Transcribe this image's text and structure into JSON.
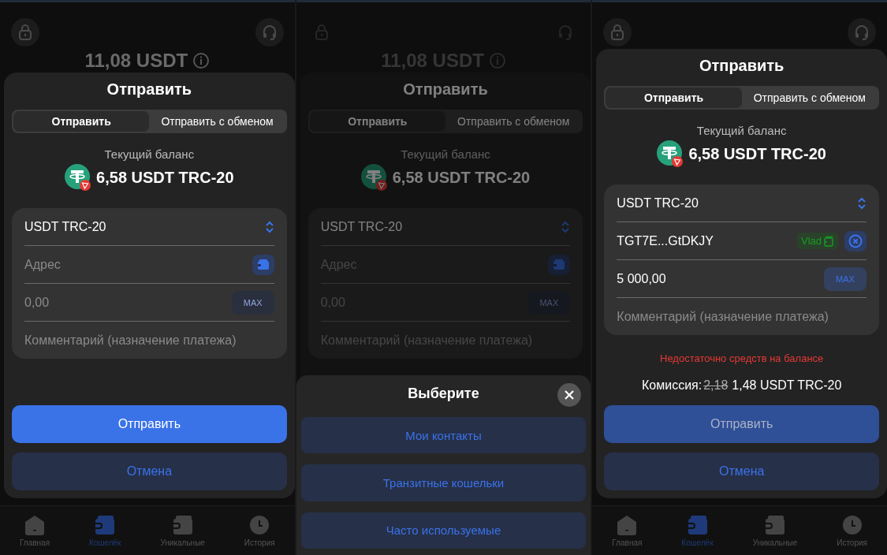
{
  "screens": [
    {
      "total_balance": "11,08 USDT",
      "dimmed": false,
      "sheet": {
        "title": "Отправить",
        "tabs": [
          {
            "label": "Отправить",
            "selected": true
          },
          {
            "label": "Отправить с обменом",
            "selected": false
          }
        ],
        "balance_label": "Текущий баланс",
        "balance": "6,58 USDT TRC-20",
        "asset": "USDT TRC-20",
        "address": {
          "placeholder": "Адрес"
        },
        "amount": {
          "placeholder": "0,00",
          "max_label": "MAX",
          "max_enabled": false
        },
        "comment": {
          "placeholder": "Комментарий (назначение платежа)"
        },
        "buttons": [
          {
            "label": "Отправить",
            "kind": "primary",
            "disabled": false
          },
          {
            "label": "Отмена",
            "kind": "secondary",
            "disabled": false
          }
        ]
      },
      "nav": [
        {
          "label": "Главная",
          "kind": "home",
          "selected": false
        },
        {
          "label": "Кошелёк",
          "kind": "wallet",
          "selected": true
        },
        {
          "label": "Уникальные",
          "kind": "unique",
          "selected": false
        },
        {
          "label": "История",
          "kind": "history",
          "selected": false
        }
      ]
    },
    {
      "total_balance": "11,08 USDT",
      "dimmed": true,
      "sheet": {
        "title": "Отправить",
        "tabs": [
          {
            "label": "Отправить",
            "selected": true
          },
          {
            "label": "Отправить с обменом",
            "selected": false
          }
        ],
        "balance_label": "Текущий баланс",
        "balance": "6,58 USDT TRC-20",
        "asset": "USDT TRC-20",
        "address": {
          "placeholder": "Адрес"
        },
        "amount": {
          "placeholder": "0,00",
          "max_label": "MAX",
          "max_enabled": false
        },
        "comment": {
          "placeholder": "Комментарий (назначение платежа)"
        }
      },
      "picker": {
        "title": "Выберите",
        "options": [
          "Мои контакты",
          "Транзитные кошельки",
          "Часто используемые"
        ]
      }
    },
    {
      "dimmed": false,
      "sheet": {
        "title": "Отправить",
        "tabs": [
          {
            "label": "Отправить",
            "selected": true
          },
          {
            "label": "Отправить с обменом",
            "selected": false
          }
        ],
        "balance_label": "Текущий баланс",
        "balance": "6,58 USDT TRC-20",
        "asset": "USDT TRC-20",
        "address": {
          "value": "TGT7E...GtDKJY",
          "contact": "Vlad"
        },
        "amount": {
          "value": "5 000,00",
          "max_label": "MAX",
          "max_enabled": true
        },
        "comment": {
          "placeholder": "Комментарий (назначение платежа)"
        },
        "error": "Недостаточно средств на балансе",
        "fee": {
          "label": "Комиссия:",
          "old_value": "2,18",
          "value": "1,48 USDT TRC-20"
        },
        "buttons": [
          {
            "label": "Отправить",
            "kind": "primary",
            "disabled": true
          },
          {
            "label": "Отмена",
            "kind": "secondary",
            "disabled": false
          }
        ]
      },
      "nav": [
        {
          "label": "Главная",
          "kind": "home",
          "selected": false
        },
        {
          "label": "Кошелёк",
          "kind": "wallet",
          "selected": true
        },
        {
          "label": "Уникальные",
          "kind": "unique",
          "selected": false
        },
        {
          "label": "История",
          "kind": "history",
          "selected": false
        }
      ]
    }
  ]
}
